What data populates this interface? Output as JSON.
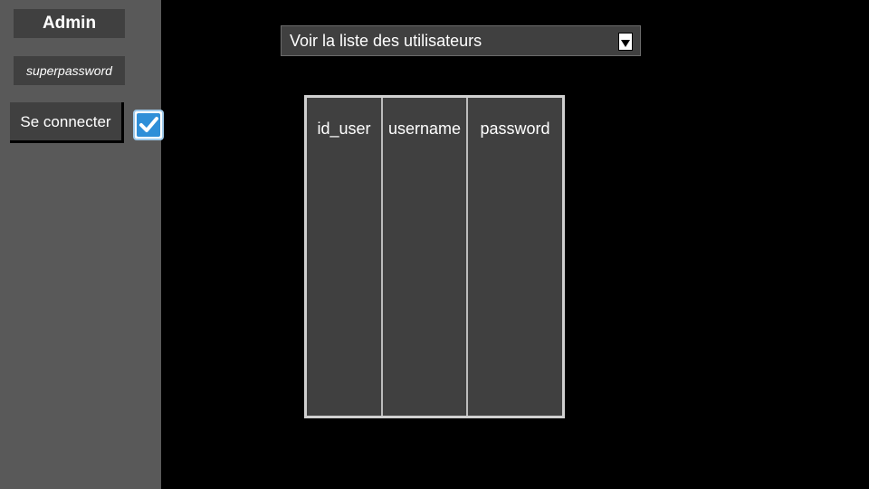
{
  "sidebar": {
    "username_value": "Admin",
    "password_value": "superpassword",
    "login_button_label": "Se connecter",
    "login_status_icon": "checked-checkbox-icon"
  },
  "main": {
    "dropdown": {
      "selected_value": "Voir la liste des utilisateurs",
      "icon": "dropdown-arrow-icon"
    },
    "table": {
      "columns": [
        "id_user",
        "username",
        "password"
      ],
      "rows": []
    }
  },
  "colors": {
    "background": "#000000",
    "sidebar": "#595959",
    "field": "#404040",
    "check_blue": "#2f8fd8"
  }
}
